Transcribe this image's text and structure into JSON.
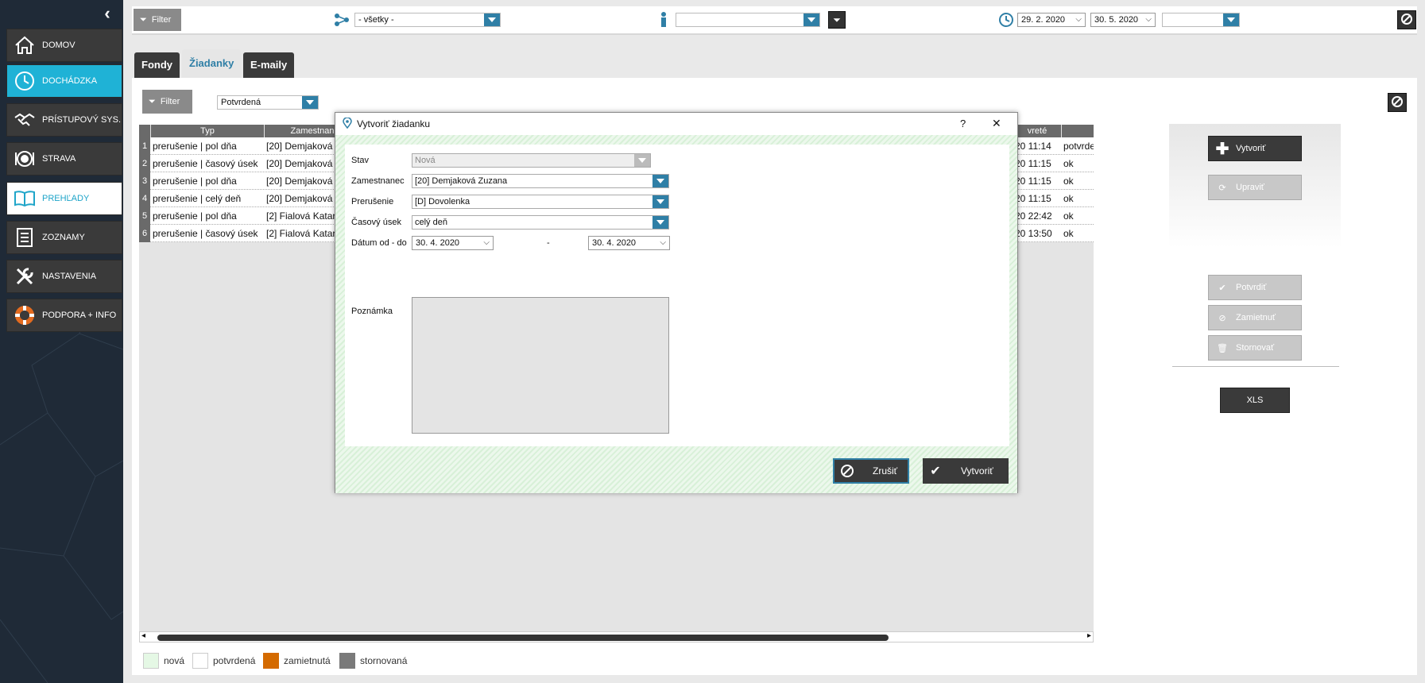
{
  "sidebar": {
    "items": [
      {
        "label": "DOMOV",
        "icon": "home-icon"
      },
      {
        "label": "DOCHÁDZKA",
        "icon": "clock-icon"
      },
      {
        "label": "PRÍSTUPOVÝ SYS.",
        "icon": "handshake-icon"
      },
      {
        "label": "STRAVA",
        "icon": "plate-icon"
      },
      {
        "label": "PREHĽADY",
        "icon": "book-icon"
      },
      {
        "label": "ZOZNAMY",
        "icon": "list-icon"
      },
      {
        "label": "NASTAVENIA",
        "icon": "tools-icon"
      },
      {
        "label": "PODPORA + INFO",
        "icon": "lifebuoy-icon"
      }
    ]
  },
  "topbar": {
    "filter_label": "Filter",
    "group_select": "- všetky -",
    "person_select": "",
    "date_from": "29. 2. 2020",
    "date_to": "30. 5. 2020",
    "extra_select": ""
  },
  "tabs": [
    "Fondy",
    "Žiadanky",
    "E-maily"
  ],
  "subfilter": {
    "filter_label": "Filter",
    "status_select": "Potvrdená"
  },
  "table": {
    "columns": {
      "typ": "Typ",
      "zamestnanec": "Zamestnan",
      "vytvorene": "vreté"
    },
    "rows": [
      {
        "n": "1",
        "typ": "prerušenie | pol dňa",
        "zam": "[20] Demjaková",
        "time": "20  11:14",
        "stav": "potvrde"
      },
      {
        "n": "2",
        "typ": "prerušenie | časový úsek",
        "zam": "[20] Demjaková",
        "time": "20  11:15",
        "stav": "ok"
      },
      {
        "n": "3",
        "typ": "prerušenie | pol dňa",
        "zam": "[20] Demjaková",
        "time": "20  11:15",
        "stav": "ok"
      },
      {
        "n": "4",
        "typ": "prerušenie | celý deň",
        "zam": "[20] Demjaková",
        "time": "20  11:15",
        "stav": "ok"
      },
      {
        "n": "5",
        "typ": "prerušenie | pol dňa",
        "zam": "[2] Fialová Katar",
        "time": "20  22:42",
        "stav": "ok"
      },
      {
        "n": "6",
        "typ": "prerušenie | časový úsek",
        "zam": "[2] Fialová Katar",
        "time": "20  13:50",
        "stav": "ok"
      }
    ]
  },
  "actions": {
    "create": "Vytvoriť",
    "edit": "Upraviť",
    "confirm": "Potvrdiť",
    "reject": "Zamietnuť",
    "cancel": "Stornovať",
    "xls": "XLS"
  },
  "legend": {
    "new": "nová",
    "confirmed": "potvrdená",
    "rejected": "zamietnutá",
    "cancelled": "stornovaná"
  },
  "colors": {
    "accent": "#1fb2d6",
    "dropdown": "#2f7fa6",
    "rejected": "#d46a00",
    "cancelled": "#7a7a7a",
    "new": "#e5f8e5"
  },
  "dialog": {
    "title": "Vytvoriť žiadanku",
    "help": "?",
    "close": "✕",
    "labels": {
      "stav": "Stav",
      "zam": "Zamestnanec",
      "prer": "Prerušenie",
      "usek": "Časový úsek",
      "datum": "Dátum od - do",
      "pozn": "Poznámka"
    },
    "values": {
      "stav": "Nová",
      "zam": "[20] Demjaková Zuzana",
      "prer": "[D] Dovolenka",
      "usek": "celý deň",
      "from": "30. 4. 2020",
      "sep": "-",
      "to": "30. 4. 2020",
      "pozn": ""
    },
    "cancel_label": "Zrušiť",
    "create_label": "Vytvoriť"
  }
}
